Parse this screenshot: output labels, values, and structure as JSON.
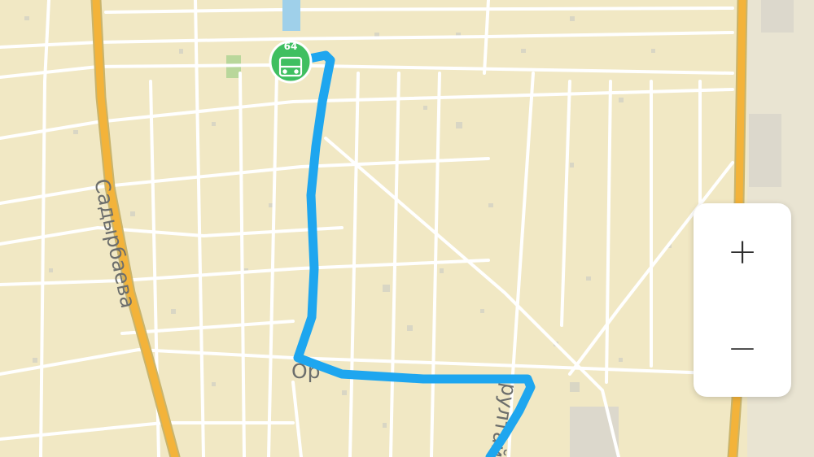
{
  "map": {
    "streets": {
      "sadyrbaeva": "Садырбаева",
      "label_partial_1": "Ор",
      "label_partial_2": "рултай"
    },
    "route": {
      "color": "#1ea6ef"
    },
    "start_marker": {
      "label": "64",
      "icon": "bus-icon",
      "color": "#3fbf60"
    }
  },
  "zoom": {
    "in_label": "+",
    "out_label": "−"
  }
}
